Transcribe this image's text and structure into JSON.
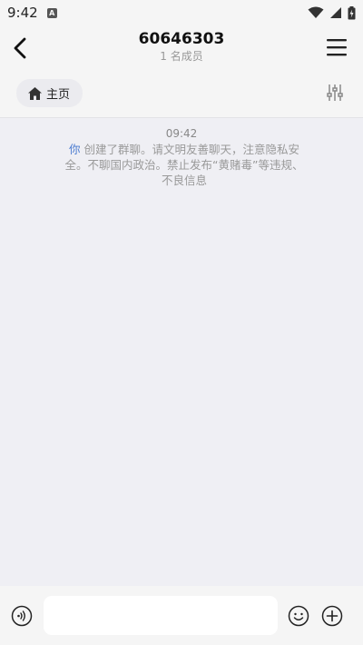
{
  "status_bar": {
    "time": "9:42",
    "app_icon_letter": "A"
  },
  "header": {
    "title": "60646303",
    "subtitle": "1 名成员"
  },
  "toolbar": {
    "home_label": "主页"
  },
  "chat": {
    "timestamp": "09:42",
    "system_message": {
      "actor": "你",
      "text": " 创建了群聊。请文明友善聊天，注意隐私安全。不聊国内政治。禁止发布“黄赌毒”等违规、不良信息"
    }
  },
  "input_bar": {
    "placeholder": "",
    "value": ""
  },
  "icons": {
    "back": "back-arrow-icon",
    "menu": "hamburger-menu-icon",
    "home": "home-icon",
    "filter": "sliders-icon",
    "voice": "voice-icon",
    "emoji": "emoji-icon",
    "plus": "plus-circle-icon"
  },
  "colors": {
    "accent": "#4a7bd0",
    "background": "#efeff4",
    "bar": "#f5f5f5"
  }
}
